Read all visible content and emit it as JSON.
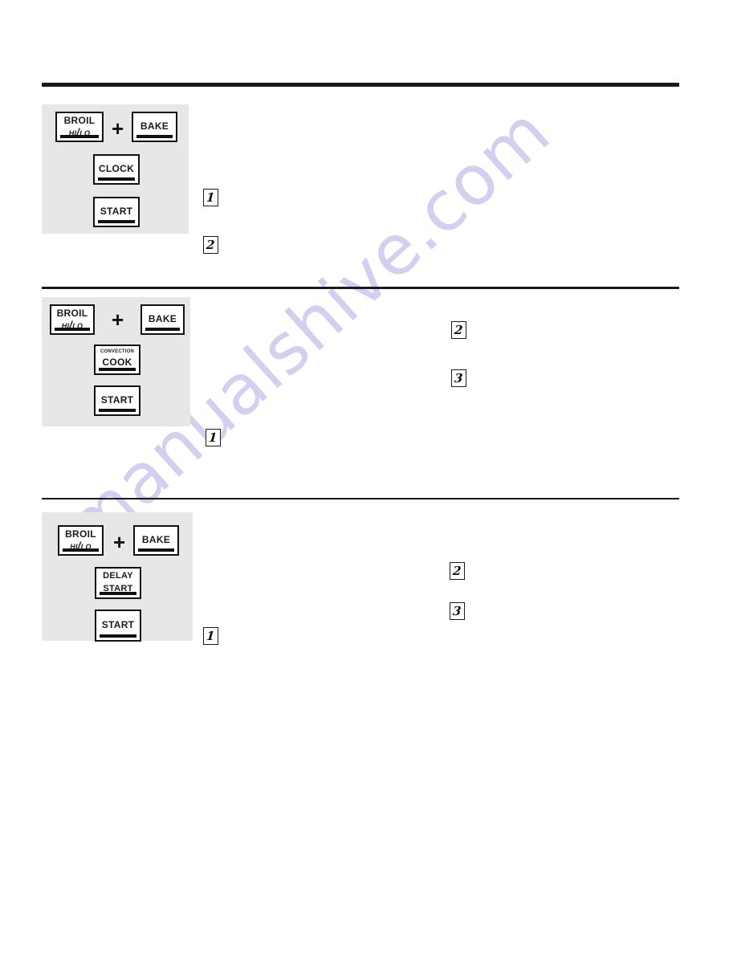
{
  "document": {
    "page_background": "#ffffff",
    "panel_color": "#e7e7e8",
    "ink_color": "#1a1a1a",
    "watermark_color": "#c9c8ef"
  },
  "watermark": {
    "text": "manualshive.com"
  },
  "keys": {
    "broil_main": "Broil",
    "broil_sub": "Hi/Lo",
    "bake": "Bake",
    "clock": "Clock",
    "start": "Start",
    "convection_top": "Convection",
    "convection_bottom": "Cook",
    "delay_top": "Delay",
    "delay_bottom": "Start",
    "plus": "+"
  },
  "sections": [
    {
      "id": "set-clock",
      "divider": "thick",
      "keys": [
        {
          "name": "broil-hi-lo-key",
          "main": "Broil",
          "sub": "Hi/Lo"
        },
        {
          "name": "plus-operator",
          "main": "+"
        },
        {
          "name": "bake-key",
          "main": "Bake"
        },
        {
          "name": "clock-key",
          "main": "Clock"
        },
        {
          "name": "start-key",
          "main": "Start"
        }
      ],
      "steps": [
        {
          "label": "1"
        },
        {
          "label": "2"
        }
      ]
    },
    {
      "id": "convection-cook",
      "divider": "thin",
      "keys": [
        {
          "name": "broil-hi-lo-key",
          "main": "Broil",
          "sub": "Hi/Lo"
        },
        {
          "name": "plus-operator",
          "main": "+"
        },
        {
          "name": "bake-key",
          "main": "Bake"
        },
        {
          "name": "convection-cook-key",
          "top": "Convection",
          "bottom": "Cook"
        },
        {
          "name": "start-key",
          "main": "Start"
        }
      ],
      "steps": [
        {
          "label": "1"
        },
        {
          "label": "2"
        },
        {
          "label": "3"
        }
      ]
    },
    {
      "id": "delay-start",
      "divider": "thinner",
      "keys": [
        {
          "name": "broil-hi-lo-key",
          "main": "Broil",
          "sub": "Hi/Lo"
        },
        {
          "name": "plus-operator",
          "main": "+"
        },
        {
          "name": "bake-key",
          "main": "Bake"
        },
        {
          "name": "delay-start-key",
          "top": "Delay",
          "bottom": "Start"
        },
        {
          "name": "start-key",
          "main": "Start"
        }
      ],
      "steps": [
        {
          "label": "1"
        },
        {
          "label": "2"
        },
        {
          "label": "3"
        }
      ]
    }
  ]
}
